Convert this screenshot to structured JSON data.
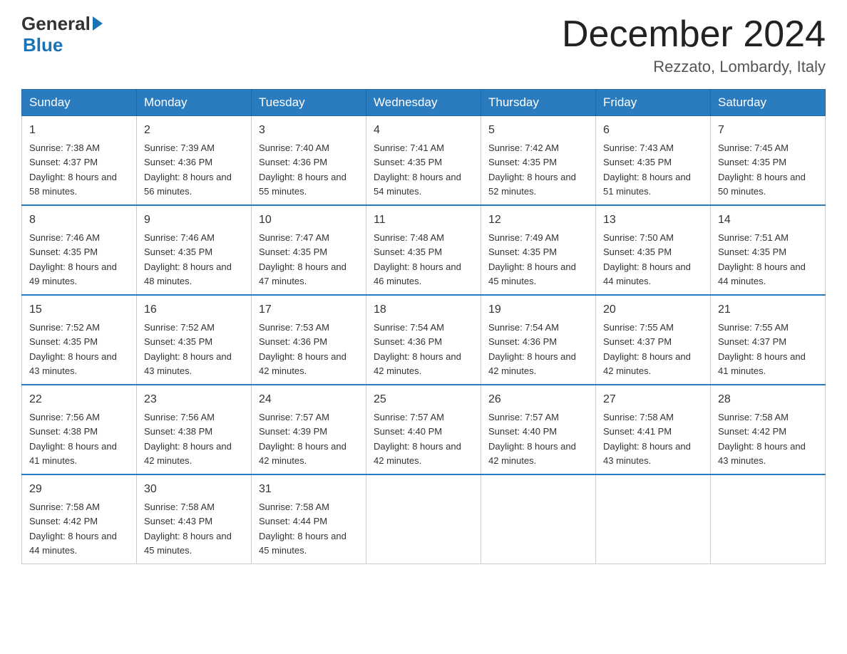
{
  "header": {
    "logo": {
      "general": "General",
      "blue": "Blue"
    },
    "title": "December 2024",
    "location": "Rezzato, Lombardy, Italy"
  },
  "calendar": {
    "columns": [
      "Sunday",
      "Monday",
      "Tuesday",
      "Wednesday",
      "Thursday",
      "Friday",
      "Saturday"
    ],
    "weeks": [
      [
        {
          "day": "1",
          "sunrise": "7:38 AM",
          "sunset": "4:37 PM",
          "daylight": "8 hours and 58 minutes."
        },
        {
          "day": "2",
          "sunrise": "7:39 AM",
          "sunset": "4:36 PM",
          "daylight": "8 hours and 56 minutes."
        },
        {
          "day": "3",
          "sunrise": "7:40 AM",
          "sunset": "4:36 PM",
          "daylight": "8 hours and 55 minutes."
        },
        {
          "day": "4",
          "sunrise": "7:41 AM",
          "sunset": "4:35 PM",
          "daylight": "8 hours and 54 minutes."
        },
        {
          "day": "5",
          "sunrise": "7:42 AM",
          "sunset": "4:35 PM",
          "daylight": "8 hours and 52 minutes."
        },
        {
          "day": "6",
          "sunrise": "7:43 AM",
          "sunset": "4:35 PM",
          "daylight": "8 hours and 51 minutes."
        },
        {
          "day": "7",
          "sunrise": "7:45 AM",
          "sunset": "4:35 PM",
          "daylight": "8 hours and 50 minutes."
        }
      ],
      [
        {
          "day": "8",
          "sunrise": "7:46 AM",
          "sunset": "4:35 PM",
          "daylight": "8 hours and 49 minutes."
        },
        {
          "day": "9",
          "sunrise": "7:46 AM",
          "sunset": "4:35 PM",
          "daylight": "8 hours and 48 minutes."
        },
        {
          "day": "10",
          "sunrise": "7:47 AM",
          "sunset": "4:35 PM",
          "daylight": "8 hours and 47 minutes."
        },
        {
          "day": "11",
          "sunrise": "7:48 AM",
          "sunset": "4:35 PM",
          "daylight": "8 hours and 46 minutes."
        },
        {
          "day": "12",
          "sunrise": "7:49 AM",
          "sunset": "4:35 PM",
          "daylight": "8 hours and 45 minutes."
        },
        {
          "day": "13",
          "sunrise": "7:50 AM",
          "sunset": "4:35 PM",
          "daylight": "8 hours and 44 minutes."
        },
        {
          "day": "14",
          "sunrise": "7:51 AM",
          "sunset": "4:35 PM",
          "daylight": "8 hours and 44 minutes."
        }
      ],
      [
        {
          "day": "15",
          "sunrise": "7:52 AM",
          "sunset": "4:35 PM",
          "daylight": "8 hours and 43 minutes."
        },
        {
          "day": "16",
          "sunrise": "7:52 AM",
          "sunset": "4:35 PM",
          "daylight": "8 hours and 43 minutes."
        },
        {
          "day": "17",
          "sunrise": "7:53 AM",
          "sunset": "4:36 PM",
          "daylight": "8 hours and 42 minutes."
        },
        {
          "day": "18",
          "sunrise": "7:54 AM",
          "sunset": "4:36 PM",
          "daylight": "8 hours and 42 minutes."
        },
        {
          "day": "19",
          "sunrise": "7:54 AM",
          "sunset": "4:36 PM",
          "daylight": "8 hours and 42 minutes."
        },
        {
          "day": "20",
          "sunrise": "7:55 AM",
          "sunset": "4:37 PM",
          "daylight": "8 hours and 42 minutes."
        },
        {
          "day": "21",
          "sunrise": "7:55 AM",
          "sunset": "4:37 PM",
          "daylight": "8 hours and 41 minutes."
        }
      ],
      [
        {
          "day": "22",
          "sunrise": "7:56 AM",
          "sunset": "4:38 PM",
          "daylight": "8 hours and 41 minutes."
        },
        {
          "day": "23",
          "sunrise": "7:56 AM",
          "sunset": "4:38 PM",
          "daylight": "8 hours and 42 minutes."
        },
        {
          "day": "24",
          "sunrise": "7:57 AM",
          "sunset": "4:39 PM",
          "daylight": "8 hours and 42 minutes."
        },
        {
          "day": "25",
          "sunrise": "7:57 AM",
          "sunset": "4:40 PM",
          "daylight": "8 hours and 42 minutes."
        },
        {
          "day": "26",
          "sunrise": "7:57 AM",
          "sunset": "4:40 PM",
          "daylight": "8 hours and 42 minutes."
        },
        {
          "day": "27",
          "sunrise": "7:58 AM",
          "sunset": "4:41 PM",
          "daylight": "8 hours and 43 minutes."
        },
        {
          "day": "28",
          "sunrise": "7:58 AM",
          "sunset": "4:42 PM",
          "daylight": "8 hours and 43 minutes."
        }
      ],
      [
        {
          "day": "29",
          "sunrise": "7:58 AM",
          "sunset": "4:42 PM",
          "daylight": "8 hours and 44 minutes."
        },
        {
          "day": "30",
          "sunrise": "7:58 AM",
          "sunset": "4:43 PM",
          "daylight": "8 hours and 45 minutes."
        },
        {
          "day": "31",
          "sunrise": "7:58 AM",
          "sunset": "4:44 PM",
          "daylight": "8 hours and 45 minutes."
        },
        null,
        null,
        null,
        null
      ]
    ]
  }
}
